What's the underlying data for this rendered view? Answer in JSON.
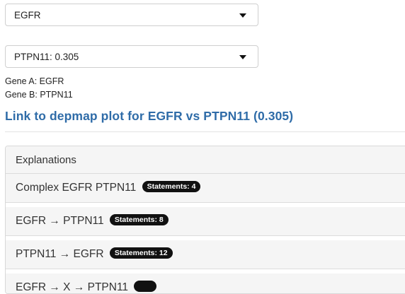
{
  "selects": {
    "gene_a": "EGFR",
    "gene_b": "PTPN11: 0.305"
  },
  "genes": {
    "gene_a_line": "Gene A: EGFR",
    "gene_b_line": "Gene B: PTPN11"
  },
  "depmap_link": "Link to depmap plot for EGFR vs PTPN11 (0.305)",
  "explanations": {
    "title": "Explanations",
    "items": [
      {
        "label": "Complex EGFR PTPN11",
        "badge": "Statements: 4"
      },
      {
        "label": "EGFR → PTPN11",
        "badge": "Statements: 8"
      },
      {
        "label": "PTPN11 → EGFR",
        "badge": "Statements: 12"
      },
      {
        "label": "EGFR → X → PTPN11",
        "badge": ""
      }
    ]
  },
  "colors": {
    "link": "#2f6ca8",
    "badge_bg": "#111111",
    "panel_bg": "#f5f5f5"
  }
}
